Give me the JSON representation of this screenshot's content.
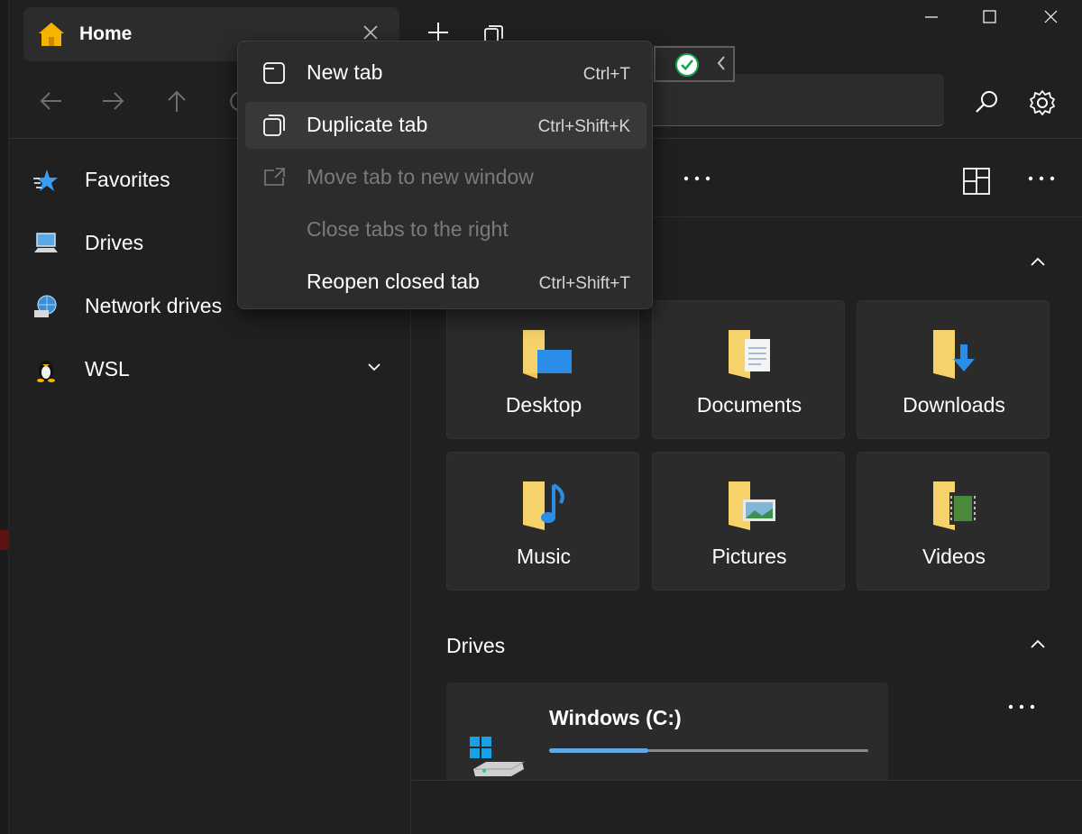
{
  "tab": {
    "title": "Home",
    "close_label": "✕"
  },
  "window": {
    "min": "minimize",
    "max": "maximize",
    "close": "close"
  },
  "toolbar": {
    "address_value": ""
  },
  "sidebar": {
    "items": [
      {
        "label": "Favorites",
        "icon": "favorites-star-icon"
      },
      {
        "label": "Drives",
        "icon": "drives-computer-icon"
      },
      {
        "label": "Network drives",
        "icon": "network-globe-icon"
      },
      {
        "label": "WSL",
        "icon": "linux-penguin-icon"
      }
    ]
  },
  "main": {
    "folders": [
      {
        "label": "Desktop",
        "icon": "desktop-folder-icon"
      },
      {
        "label": "Documents",
        "icon": "documents-folder-icon"
      },
      {
        "label": "Downloads",
        "icon": "downloads-folder-icon"
      },
      {
        "label": "Music",
        "icon": "music-folder-icon"
      },
      {
        "label": "Pictures",
        "icon": "pictures-folder-icon"
      },
      {
        "label": "Videos",
        "icon": "videos-folder-icon"
      }
    ],
    "drives_header": "Drives",
    "drive": {
      "name": "Windows (C:)",
      "usage_fraction": 0.31
    }
  },
  "context_menu": {
    "items": [
      {
        "label": "New tab",
        "shortcut": "Ctrl+T",
        "enabled": true
      },
      {
        "label": "Duplicate tab",
        "shortcut": "Ctrl+Shift+K",
        "enabled": true,
        "hovered": true
      },
      {
        "label": "Move tab to new window",
        "shortcut": "",
        "enabled": false
      },
      {
        "label": "Close tabs to the right",
        "shortcut": "",
        "enabled": false
      },
      {
        "label": "Reopen closed tab",
        "shortcut": "Ctrl+Shift+T",
        "enabled": true
      }
    ]
  },
  "colors": {
    "accent": "#62a8e8",
    "folder_yellow": "#f4c64f",
    "bg": "#202020",
    "card": "#2b2b2b"
  }
}
